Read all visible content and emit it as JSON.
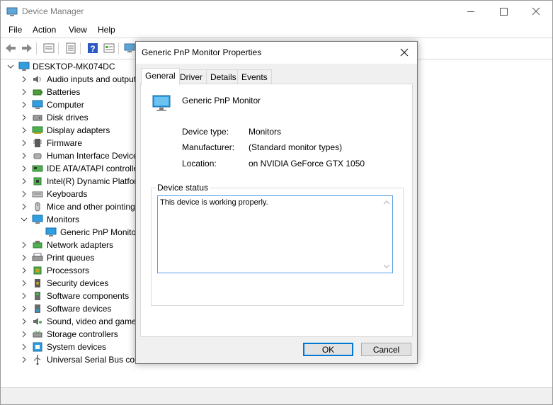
{
  "window": {
    "title": "Device Manager",
    "menu": [
      "File",
      "Action",
      "View",
      "Help"
    ]
  },
  "tree": {
    "root": "DESKTOP-MK074DC",
    "items": [
      {
        "label": "Audio inputs and outputs",
        "icon": "speaker-icon"
      },
      {
        "label": "Batteries",
        "icon": "battery-icon"
      },
      {
        "label": "Computer",
        "icon": "computer-icon"
      },
      {
        "label": "Disk drives",
        "icon": "disk-drive-icon"
      },
      {
        "label": "Display adapters",
        "icon": "display-adapter-icon"
      },
      {
        "label": "Firmware",
        "icon": "firmware-icon"
      },
      {
        "label": "Human Interface Devices",
        "icon": "hid-icon"
      },
      {
        "label": "IDE ATA/ATAPI controllers",
        "icon": "ide-controller-icon"
      },
      {
        "label": "Intel(R) Dynamic Platform and Thermal Framework",
        "icon": "chip-icon"
      },
      {
        "label": "Keyboards",
        "icon": "keyboard-icon"
      },
      {
        "label": "Mice and other pointing devices",
        "icon": "mouse-icon"
      },
      {
        "label": "Monitors",
        "icon": "monitor-icon"
      },
      {
        "label": "Generic PnP Monitor",
        "icon": "monitor-icon"
      },
      {
        "label": "Network adapters",
        "icon": "network-adapter-icon"
      },
      {
        "label": "Print queues",
        "icon": "printer-icon"
      },
      {
        "label": "Processors",
        "icon": "processor-icon"
      },
      {
        "label": "Security devices",
        "icon": "security-device-icon"
      },
      {
        "label": "Software components",
        "icon": "software-component-icon"
      },
      {
        "label": "Software devices",
        "icon": "software-device-icon"
      },
      {
        "label": "Sound, video and game controllers",
        "icon": "sound-icon"
      },
      {
        "label": "Storage controllers",
        "icon": "storage-controller-icon"
      },
      {
        "label": "System devices",
        "icon": "system-device-icon"
      },
      {
        "label": "Universal Serial Bus controllers",
        "icon": "usb-icon"
      }
    ]
  },
  "dialog": {
    "title": "Generic PnP Monitor Properties",
    "tabs": [
      "General",
      "Driver",
      "Details",
      "Events"
    ],
    "device_name": "Generic PnP Monitor",
    "fields": [
      {
        "label": "Device type:",
        "value": "Monitors"
      },
      {
        "label": "Manufacturer:",
        "value": "(Standard monitor types)"
      },
      {
        "label": "Location:",
        "value": "on NVIDIA GeForce GTX 1050"
      }
    ],
    "status_caption": "Device status",
    "status_text": "This device is working properly.",
    "ok_label": "OK",
    "cancel_label": "Cancel"
  },
  "colors": {
    "accent": "#0078d7",
    "monitor_blue": "#2f9fe0"
  }
}
